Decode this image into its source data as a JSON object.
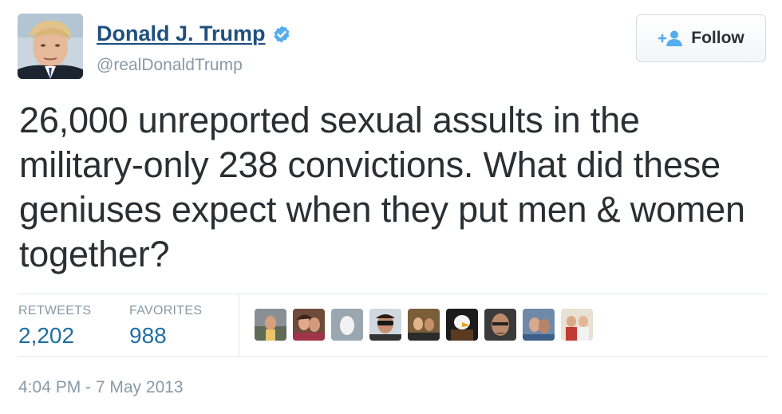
{
  "user": {
    "display_name": "Donald J. Trump",
    "handle": "@realDonaldTrump",
    "verified_icon": "verified-badge-icon",
    "avatar_icon": "profile-avatar"
  },
  "follow_button": {
    "label": "Follow",
    "icon": "add-user-icon"
  },
  "tweet": {
    "text": "26,000 unreported sexual assults in the military-only 238 convictions. What did these geniuses expect when they put men & women together?"
  },
  "stats": {
    "retweets_label": "RETWEETS",
    "retweets_value": "2,202",
    "favorites_label": "FAVORITES",
    "favorites_value": "988"
  },
  "favoriters": [
    "favoriter-avatar-1",
    "favoriter-avatar-2",
    "favoriter-avatar-3",
    "favoriter-avatar-4",
    "favoriter-avatar-5",
    "favoriter-avatar-6",
    "favoriter-avatar-7",
    "favoriter-avatar-8",
    "favoriter-avatar-9"
  ],
  "timestamp": "4:04 PM - 7 May 2013",
  "colors": {
    "name_link": "#1f4f7e",
    "verified": "#55acee",
    "stat_value": "#1f6fa3",
    "muted": "#8899a6",
    "text": "#292f33"
  }
}
